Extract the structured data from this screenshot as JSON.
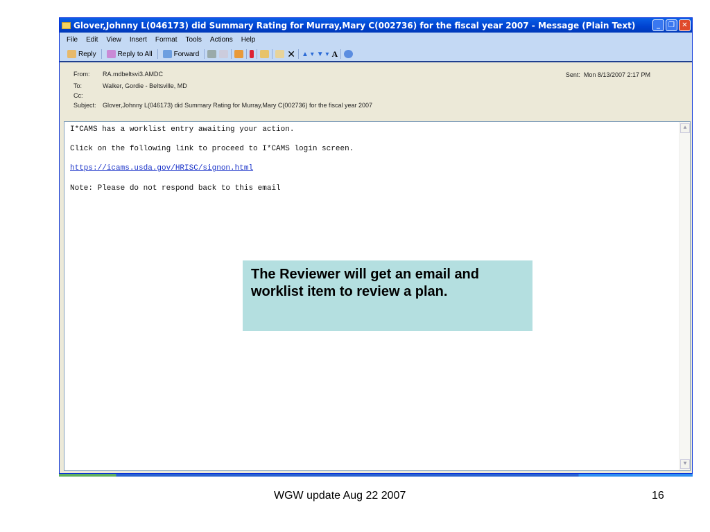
{
  "window": {
    "title": "Glover,Johnny L(046173) did Summary Rating for Murray,Mary C(002736) for the fiscal year 2007 - Message (Plain Text)"
  },
  "menu": [
    "File",
    "Edit",
    "View",
    "Insert",
    "Format",
    "Tools",
    "Actions",
    "Help"
  ],
  "toolbar": {
    "reply": "Reply",
    "reply_all": "Reply to All",
    "forward": "Forward"
  },
  "header": {
    "from_label": "From:",
    "from": "RA.mdbeltsvi3.AMDC",
    "to_label": "To:",
    "to": "Walker, Gordie - Beltsville, MD",
    "cc_label": "Cc:",
    "cc": "",
    "subject_label": "Subject:",
    "subject": "Glover,Johnny L(046173) did Summary Rating for Murray,Mary C(002736) for the fiscal year 2007",
    "sent_label": "Sent:",
    "sent": "Mon 8/13/2007 2:17 PM"
  },
  "body": {
    "line1": "I*CAMS has a worklist entry awaiting your action.",
    "line2": "Click on the following link to proceed to I*CAMS login screen.",
    "link": "https://icams.usda.gov/HRISC/signon.html",
    "line3": "Note: Please do not respond back to this email"
  },
  "callout": "The Reviewer will get an email and worklist item to review a plan.",
  "footer": {
    "caption": "WGW update Aug 22 2007",
    "page": "16"
  }
}
